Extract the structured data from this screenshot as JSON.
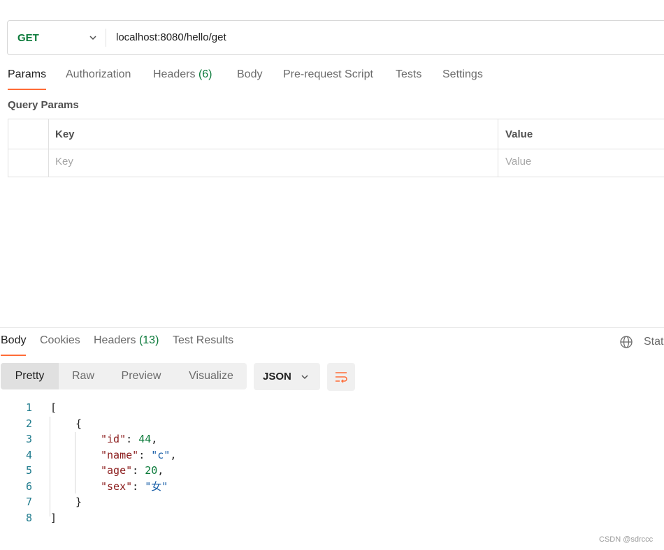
{
  "request": {
    "method": "GET",
    "url": "localhost:8080/hello/get"
  },
  "request_tabs": [
    {
      "label": "Params",
      "active": true
    },
    {
      "label": "Authorization"
    },
    {
      "label": "Headers",
      "count": "(6)"
    },
    {
      "label": "Body"
    },
    {
      "label": "Pre-request Script"
    },
    {
      "label": "Tests"
    },
    {
      "label": "Settings"
    }
  ],
  "query_params": {
    "title": "Query Params",
    "header_key": "Key",
    "header_value": "Value",
    "placeholder_key": "Key",
    "placeholder_value": "Value"
  },
  "response_tabs": [
    {
      "label": "Body",
      "active": true
    },
    {
      "label": "Cookies"
    },
    {
      "label": "Headers",
      "count": "(13)"
    },
    {
      "label": "Test Results"
    }
  ],
  "response_status_label": "Stat",
  "format_tabs": [
    {
      "label": "Pretty",
      "active": true
    },
    {
      "label": "Raw"
    },
    {
      "label": "Preview"
    },
    {
      "label": "Visualize"
    }
  ],
  "format_select": "JSON",
  "code_lines": [
    {
      "n": "1",
      "indent": 0,
      "parts": [
        {
          "t": "[",
          "c": "p"
        }
      ]
    },
    {
      "n": "2",
      "indent": 1,
      "parts": [
        {
          "t": "{",
          "c": "p"
        }
      ]
    },
    {
      "n": "3",
      "indent": 2,
      "parts": [
        {
          "t": "\"id\"",
          "c": "k"
        },
        {
          "t": ": ",
          "c": "p"
        },
        {
          "t": "44",
          "c": "n"
        },
        {
          "t": ",",
          "c": "p"
        }
      ]
    },
    {
      "n": "4",
      "indent": 2,
      "parts": [
        {
          "t": "\"name\"",
          "c": "k"
        },
        {
          "t": ": ",
          "c": "p"
        },
        {
          "t": "\"c\"",
          "c": "s"
        },
        {
          "t": ",",
          "c": "p"
        }
      ]
    },
    {
      "n": "5",
      "indent": 2,
      "parts": [
        {
          "t": "\"age\"",
          "c": "k"
        },
        {
          "t": ": ",
          "c": "p"
        },
        {
          "t": "20",
          "c": "n"
        },
        {
          "t": ",",
          "c": "p"
        }
      ]
    },
    {
      "n": "6",
      "indent": 2,
      "parts": [
        {
          "t": "\"sex\"",
          "c": "k"
        },
        {
          "t": ": ",
          "c": "p"
        },
        {
          "t": "\"女\"",
          "c": "s"
        }
      ]
    },
    {
      "n": "7",
      "indent": 1,
      "parts": [
        {
          "t": "}",
          "c": "p"
        }
      ]
    },
    {
      "n": "8",
      "indent": 0,
      "parts": [
        {
          "t": "]",
          "c": "p"
        }
      ]
    }
  ],
  "watermark": "CSDN @sdrccc",
  "colors": {
    "accent": "#ff6c37",
    "method_get": "#0b7a3a",
    "json_key": "#8b1c1c",
    "json_string": "#1a5fa8",
    "json_number": "#0b7a3a"
  }
}
